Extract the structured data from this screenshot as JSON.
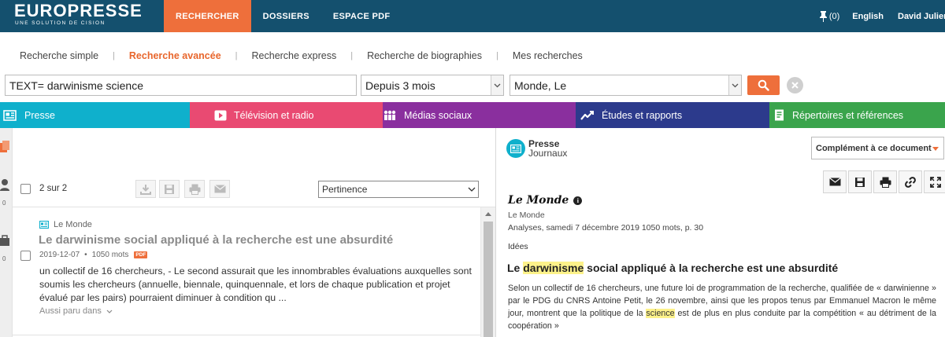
{
  "brand": {
    "name": "EUROPRESSE",
    "tagline": "UNE SOLUTION DE CISION"
  },
  "topnav": [
    {
      "label": "RECHERCHER",
      "active": true
    },
    {
      "label": "DOSSIERS",
      "active": false
    },
    {
      "label": "ESPACE PDF",
      "active": false
    }
  ],
  "topright": {
    "pin_count": "(0)",
    "language": "English",
    "user": "David Julien"
  },
  "subnav": [
    {
      "label": "Recherche simple",
      "active": false
    },
    {
      "label": "Recherche avancée",
      "active": true
    },
    {
      "label": "Recherche express",
      "active": false
    },
    {
      "label": "Recherche de biographies",
      "active": false
    },
    {
      "label": "Mes recherches",
      "active": false
    }
  ],
  "search": {
    "query": "TEXT= darwinisme science",
    "period": "Depuis 3 mois",
    "source": "Monde, Le"
  },
  "categories": [
    {
      "label": "Presse",
      "icon": "newspaper-icon",
      "color": "#0fb0cc"
    },
    {
      "label": "Télévision et radio",
      "icon": "play-icon",
      "color": "#e94a72"
    },
    {
      "label": "Médias sociaux",
      "icon": "people-icon",
      "color": "#8a2f9e"
    },
    {
      "label": "Études et rapports",
      "icon": "trend-line-icon",
      "color": "#2c3a8c"
    },
    {
      "label": "Répertoires et références",
      "icon": "directory-icon",
      "color": "#3aa44c"
    }
  ],
  "leftstrip": {
    "count_a": "0",
    "count_b": "0"
  },
  "results": {
    "count": "2 sur 2",
    "sort": "Pertinence",
    "items": [
      {
        "source": "Le Monde",
        "title": "Le darwinisme social appliqué à la recherche est une absurdité",
        "date": "2019-12-07",
        "separator": "•",
        "words": "1050 mots",
        "badge": "PDF",
        "snippet": "un collectif de 16 chercheurs, - Le second assurait que les innombrables évaluations auxquelles sont soumis les chercheurs (annuelle, biennale, quinquennale, et lors de chaque publication et projet évalué par les pairs) pourraient diminuer à condition qu ...",
        "also": "Aussi paru dans"
      }
    ]
  },
  "document": {
    "type_main": "Presse",
    "type_sub": "Journaux",
    "complement": "Complément à ce document",
    "publication": "Le Monde",
    "info": "i",
    "source": "Le Monde",
    "edition": "Analyses, samedi 7 décembre 2019 1050 mots, p. 30",
    "section": "Idées",
    "title_pre": "Le ",
    "title_hl": "darwinisme",
    "title_post": " social appliqué à la recherche est une absurdité",
    "body_1": "Selon un collectif de 16 chercheurs, une future loi de programmation de la recherche, qualifiée de « darwinienne » par le PDG du CNRS Antoine Petit, le 26 novembre, ainsi que les propos tenus par Emmanuel Macron le même jour, montrent que la politique de la ",
    "body_hl": "science",
    "body_2": " est de plus en plus conduite par la compétition « au détriment de la coopération »"
  }
}
